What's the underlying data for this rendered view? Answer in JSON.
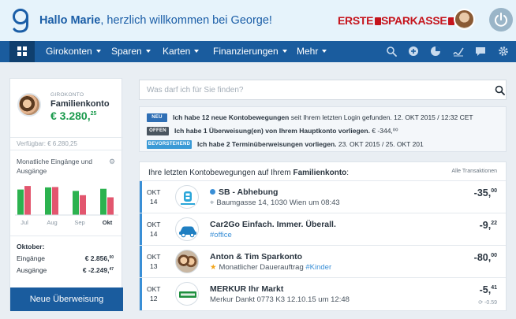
{
  "header": {
    "greeting_bold": "Hallo Marie",
    "greeting_rest": ", herzlich willkommen bei George!",
    "brand_erste": "ERSTE",
    "brand_sparkasse": "SPARKASSE"
  },
  "nav": {
    "items": [
      "Girokonten",
      "Sparen",
      "Karten",
      "Finanzierungen",
      "Mehr"
    ],
    "icons": [
      "search-icon",
      "add-icon",
      "chart-icon",
      "signature-icon",
      "message-icon",
      "settings-icon"
    ]
  },
  "account": {
    "type": "GIROKONTO",
    "name": "Familienkonto",
    "balance_main": "€ 3.280,",
    "balance_cents": "25",
    "available": "Verfügbar: € 6.280,25",
    "chart_title": "Monatliche Eingänge und Ausgänge",
    "october_label": "Oktober:",
    "income_label": "Eingänge",
    "income_value": "€ 2.856,",
    "income_cents": "00",
    "expense_label": "Ausgänge",
    "expense_value": "€ -2.249,",
    "expense_cents": "47",
    "new_transfer": "Neue Überweisung",
    "colors": {
      "income": "#2cb24f",
      "expense": "#e2566e",
      "balance": "#1b9a4d"
    }
  },
  "chart_data": {
    "type": "bar",
    "title": "Monatliche Eingänge und Ausgänge",
    "categories": [
      "Jul",
      "Aug",
      "Sep",
      "Okt"
    ],
    "series": [
      {
        "name": "Eingänge",
        "values": [
          0.72,
          0.78,
          0.68,
          0.74
        ]
      },
      {
        "name": "Ausgänge",
        "values": [
          0.82,
          0.79,
          0.56,
          0.5
        ]
      }
    ],
    "highlighted_category": "Okt"
  },
  "search": {
    "placeholder": "Was darf ich für Sie finden?"
  },
  "notifications": [
    {
      "badge": "NEU",
      "badge_color": "#2f6fb5",
      "bold": "Ich habe 12 neue Kontobewegungen",
      "rest": " seit Ihrem letzten Login gefunden. 12. OKT 2015 / 12:32 CET"
    },
    {
      "badge": "OFFEN",
      "badge_color": "#4b5660",
      "bold": "Ich habe 1 Überweisung(en) von Ihrem Hauptkonto vorliegen.",
      "rest": " € -344,⁰⁰"
    },
    {
      "badge": "BEVORSTEHEND",
      "badge_color": "#3a9ad6",
      "bold": "Ich habe 2 Terminüberweisungen vorliegen.",
      "rest": " 23. OKT 2015 / 25. OKT 201"
    }
  ],
  "transactions": {
    "title_prefix": "Ihre letzten Kontobewegungen auf Ihrem ",
    "title_account": "Familienkonto",
    "title_suffix": ":",
    "all_link": "Alle Transaktionen",
    "rows": [
      {
        "month": "OKT",
        "day": "14",
        "name": "SB - Abhebung",
        "sub": "Baumgasse 14, 1030 Wien um 08:43",
        "tag": "",
        "amount": "-35,",
        "cents": "00",
        "logo": "atm-icon"
      },
      {
        "month": "OKT",
        "day": "14",
        "name": "Car2Go Einfach. Immer. Überall.",
        "sub": "",
        "tag": "#office",
        "amount": "-9,",
        "cents": "22",
        "logo": "car-icon"
      },
      {
        "month": "OKT",
        "day": "13",
        "name": "Anton & Tim Sparkonto",
        "sub": "Monatlicher Dauerauftrag",
        "tag": "#Kinder",
        "amount": "-80,",
        "cents": "00",
        "logo": "photo-avatar"
      },
      {
        "month": "OKT",
        "day": "12",
        "name": "MERKUR Ihr Markt",
        "sub": "Merkur Dankt 0773 K3 12.10.15 um 12:48",
        "tag": "",
        "amount": "-5,",
        "cents": "41",
        "sub_amount": "-0.59",
        "logo": "merkur-icon"
      }
    ]
  }
}
